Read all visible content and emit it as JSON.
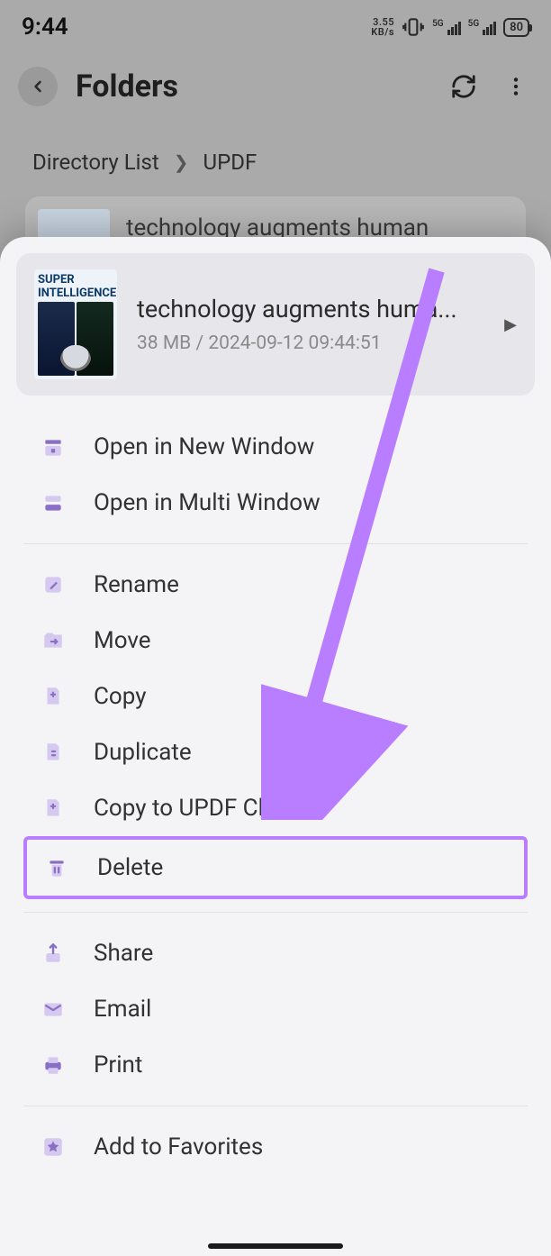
{
  "status": {
    "time": "9:44",
    "data_rate_top": "3.55",
    "data_rate_bottom": "KB/s",
    "net1_label": "5G",
    "net2_label": "5G",
    "battery": "80"
  },
  "header": {
    "title": "Folders"
  },
  "breadcrumb": {
    "root": "Directory List",
    "current": "UPDF"
  },
  "bg_file": {
    "name": "technology augments human"
  },
  "file": {
    "thumb_line1": "SUPER",
    "thumb_line2": "INTELLIGENCE",
    "name": "technology augments huma...",
    "meta": "38 MB / 2024-09-12 09:44:51"
  },
  "menu": {
    "open_new_window": "Open in New Window",
    "open_multi_window": "Open in Multi Window",
    "rename": "Rename",
    "move": "Move",
    "copy": "Copy",
    "duplicate": "Duplicate",
    "copy_cloud": "Copy to UPDF Cloud",
    "delete": "Delete",
    "share": "Share",
    "email": "Email",
    "print": "Print",
    "add_favorites": "Add to Favorites"
  }
}
